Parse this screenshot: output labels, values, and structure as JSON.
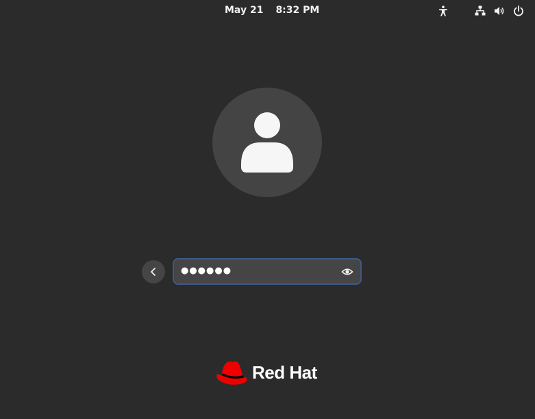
{
  "topbar": {
    "date": "May 21",
    "time": "8:32 PM",
    "icons": [
      "accessibility-icon",
      "network-wired-icon",
      "volume-icon",
      "power-icon"
    ]
  },
  "login": {
    "avatar_icon": "user-silhouette-icon",
    "back_icon": "chevron-left-icon",
    "password_masked": "●●●●●●",
    "reveal_icon": "eye-icon"
  },
  "branding": {
    "logo_icon": "redhat-fedora-icon",
    "name": "Red Hat",
    "logo_color": "#ee0000"
  },
  "colors": {
    "background": "#2b2b2b",
    "field_background": "#454545",
    "focus_ring": "#3d5a86"
  }
}
